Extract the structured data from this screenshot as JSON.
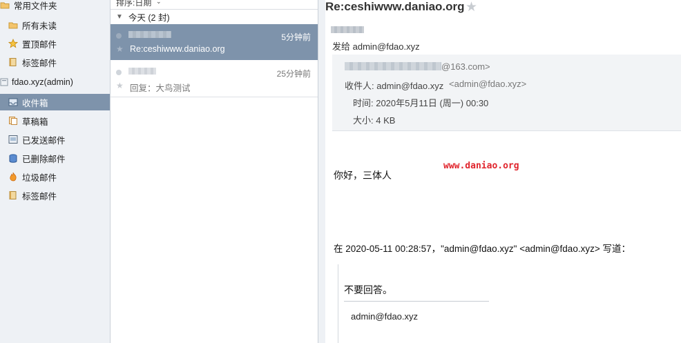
{
  "sidebar": {
    "favorites_header": "常用文件夹",
    "favorites": [
      {
        "label": "所有未读",
        "icon": "folder-icon"
      },
      {
        "label": "置顶邮件",
        "icon": "star-icon"
      },
      {
        "label": "标签邮件",
        "icon": "tag-folder-icon"
      }
    ],
    "account_header": "fdao.xyz(admin)",
    "folders": [
      {
        "label": "收件箱",
        "icon": "inbox-icon",
        "selected": true
      },
      {
        "label": "草稿箱",
        "icon": "draft-icon"
      },
      {
        "label": "已发送邮件",
        "icon": "sent-icon"
      },
      {
        "label": "已删除邮件",
        "icon": "trash-icon"
      },
      {
        "label": "垃圾邮件",
        "icon": "spam-fire-icon"
      },
      {
        "label": "标签邮件",
        "icon": "tag-folder-icon"
      }
    ]
  },
  "list": {
    "sort_label": "排序:日期",
    "group_label": "今天 (2 封)",
    "messages": [
      {
        "time": "5分钟前",
        "subject": "Re:ceshiwww.daniao.org",
        "selected": true
      },
      {
        "time": "25分钟前",
        "subject": "回复：大鸟测试",
        "selected": false
      }
    ]
  },
  "reader": {
    "title": "Re:ceshiwww.daniao.org",
    "to_line": "发给 admin@fdao.xyz",
    "sender_suffix": "@163.com>",
    "recipient_label": "收件人: admin@fdao.xyz",
    "recipient_addr": "<admin@fdao.xyz>",
    "time_label": "时间: 2020年5月11日 (周一) 00:30",
    "size_label": "大小: 4 KB",
    "greeting": "你好，三体人",
    "watermark": "www.daniao.org",
    "quote_intro": "在 2020-05-11 00:28:57，\"admin@fdao.xyz\" <admin@fdao.xyz> 写道：",
    "quote_text": "不要回答。",
    "quote_signature": "admin@fdao.xyz"
  },
  "colors": {
    "selection_bg": "#7e93ab",
    "sidebar_bg": "#eef1f5",
    "watermark_red": "#e0242c"
  }
}
